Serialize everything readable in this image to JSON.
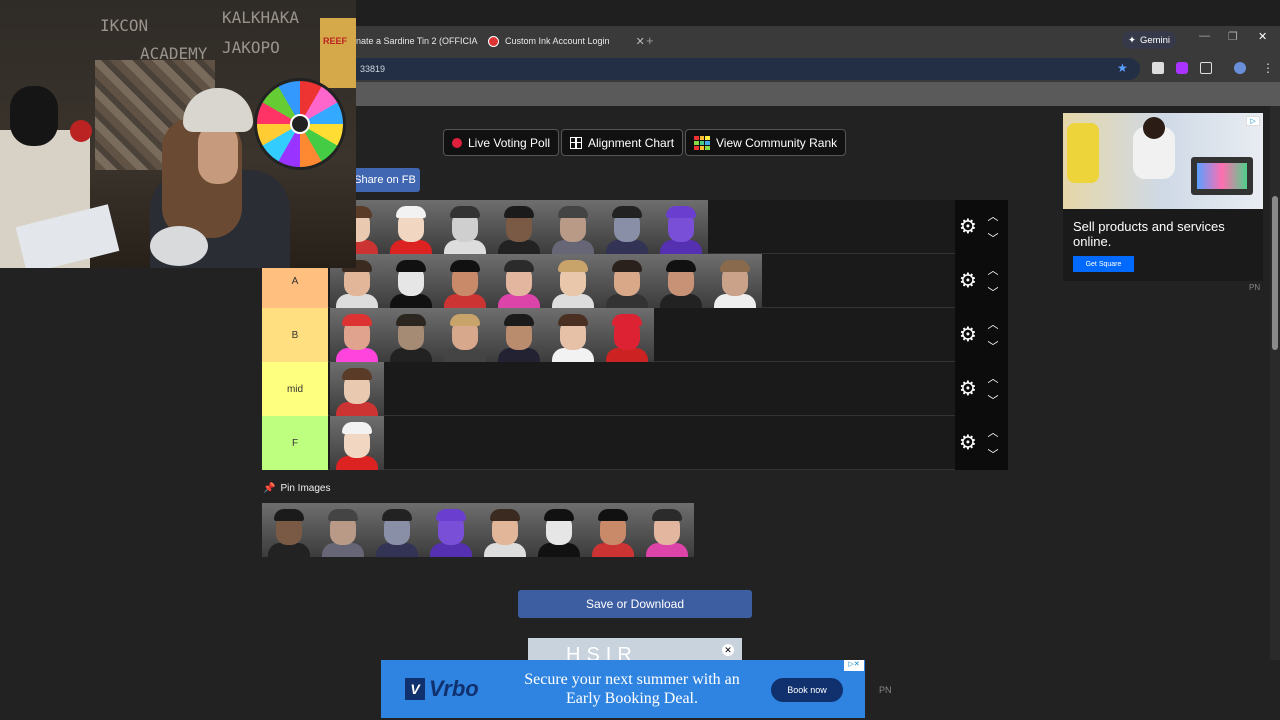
{
  "browser": {
    "tabs": [
      {
        "title": "nate a Sardine Tin 2 (OFFICIA"
      },
      {
        "title": "Custom Ink Account Login"
      }
    ],
    "new_tab": "+",
    "gemini_label": "Gemini",
    "url_fragment": "33819",
    "window_controls": {
      "minimize": "—",
      "restore": "❐",
      "close": "✕"
    }
  },
  "toolbar": {
    "live_voting_label": "Live Voting Poll",
    "alignment_chart_label": "Alignment Chart",
    "community_rank_label": "View Community Rank",
    "share_fb_label": "Share on FB"
  },
  "tiers": [
    {
      "label": "",
      "color": "#ff7f7f",
      "item_count": 7
    },
    {
      "label": "A",
      "color": "#ffbf7f",
      "item_count": 8
    },
    {
      "label": "B",
      "color": "#ffdf7f",
      "item_count": 6
    },
    {
      "label": "mid",
      "color": "#ffff7f",
      "item_count": 1
    },
    {
      "label": "F",
      "color": "#bfff7f",
      "item_count": 1
    }
  ],
  "pin": {
    "label": "Pin Images",
    "image_count": 8
  },
  "save_label": "Save or Download",
  "ads": {
    "square_text": "Sell products and services online.",
    "square_button": "Get Square",
    "pn_label": "PN",
    "small_ad_text": "HSIR",
    "vrbo_brand": "Vrbo",
    "vrbo_text": "Secure your next summer with an Early Booking Deal.",
    "vrbo_button": "Book now"
  },
  "webcam": {
    "scrawl_1": "IKCON",
    "scrawl_2": "KALKHAKA",
    "scrawl_3": "ACADEMY",
    "scrawl_4": "JAKOPO",
    "poster_text": "REEF"
  }
}
